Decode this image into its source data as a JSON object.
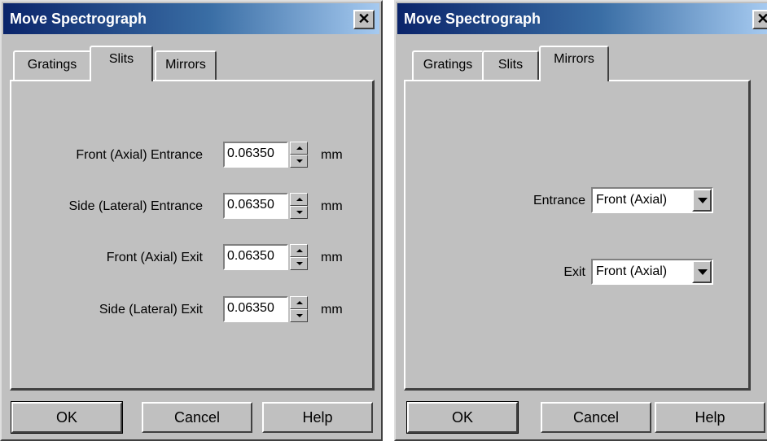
{
  "dialogs": [
    {
      "title": "Move Spectrograph",
      "close_glyph": "✕",
      "close_icon": "close-icon",
      "tabs": [
        {
          "label": "Gratings",
          "active": false
        },
        {
          "label": "Slits",
          "active": true
        },
        {
          "label": "Mirrors",
          "active": false
        }
      ],
      "fields": [
        {
          "label": "Front (Axial) Entrance",
          "value": "0.06350",
          "unit": "mm"
        },
        {
          "label": "Side (Lateral) Entrance",
          "value": "0.06350",
          "unit": "mm"
        },
        {
          "label": "Front (Axial) Exit",
          "value": "0.06350",
          "unit": "mm"
        },
        {
          "label": "Side (Lateral) Exit",
          "value": "0.06350",
          "unit": "mm"
        }
      ],
      "buttons": {
        "ok": "OK",
        "cancel": "Cancel",
        "help": "Help"
      }
    },
    {
      "title": "Move Spectrograph",
      "close_glyph": "✕",
      "close_icon": "close-icon",
      "tabs": [
        {
          "label": "Gratings",
          "active": false
        },
        {
          "label": "Slits",
          "active": false
        },
        {
          "label": "Mirrors",
          "active": true
        }
      ],
      "selects": [
        {
          "label": "Entrance",
          "value": "Front (Axial)"
        },
        {
          "label": "Exit",
          "value": "Front (Axial)"
        }
      ],
      "buttons": {
        "ok": "OK",
        "cancel": "Cancel",
        "help": "Help"
      }
    }
  ],
  "colors": {
    "face": "#c0c0c0",
    "titlebar_start": "#0a246a",
    "titlebar_end": "#a6caf0"
  }
}
